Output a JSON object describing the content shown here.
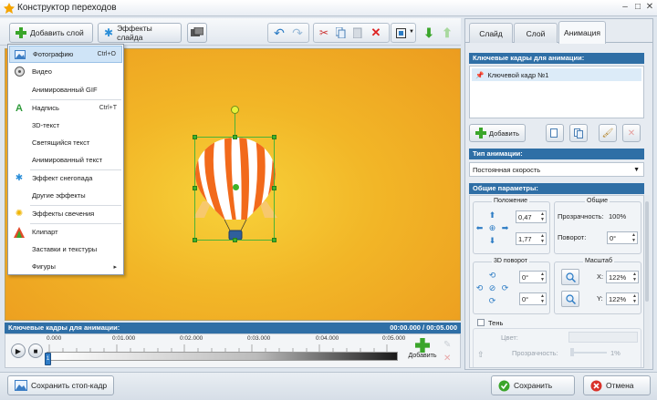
{
  "window": {
    "title": "Конструктор переходов",
    "controls": [
      "minimize-icon",
      "maximize-icon",
      "close-icon"
    ]
  },
  "toolbar": {
    "add_layer_label": "Добавить слой",
    "slide_effects_label": "Эффекты слайда",
    "icons": [
      "add-icon",
      "effects-icon",
      "slideshow-icon",
      "undo-icon",
      "redo-icon",
      "cut-icon",
      "copy-icon",
      "paste-icon",
      "delete-icon",
      "fit-icon",
      "move-down-icon",
      "move-up-icon"
    ]
  },
  "menu": {
    "items": [
      {
        "label": "Фотографию",
        "shortcut": "Ctrl+O",
        "icon": "photo-icon",
        "highlighted": true
      },
      {
        "label": "Видео",
        "shortcut": "",
        "icon": "video-icon"
      },
      {
        "label": "Анимированный GIF",
        "shortcut": "",
        "icon": "gif-icon"
      },
      {
        "label": "Надпись",
        "shortcut": "Ctrl+T",
        "icon": "text-icon"
      },
      {
        "label": "3D-текст",
        "shortcut": "",
        "icon": "text3d-icon"
      },
      {
        "label": "Светящийся текст",
        "shortcut": "",
        "icon": "glow-text-icon"
      },
      {
        "label": "Анимированный текст",
        "shortcut": "",
        "icon": "animated-text-icon"
      },
      {
        "label": "Эффект снегопада",
        "shortcut": "",
        "icon": "snowflake-icon"
      },
      {
        "label": "Другие эффекты",
        "shortcut": "",
        "icon": "effects-icon"
      },
      {
        "label": "Эффекты свечения",
        "shortcut": "",
        "icon": "glow-icon"
      },
      {
        "label": "Клипарт",
        "shortcut": "",
        "icon": "clipart-icon"
      },
      {
        "label": "Заставки и текстуры",
        "shortcut": "",
        "icon": "texture-icon"
      },
      {
        "label": "Фигуры",
        "shortcut": "",
        "icon": "shapes-icon",
        "submenu": true
      }
    ],
    "submenu_arrow": "▸"
  },
  "timeline": {
    "header": "Ключевые кадры для анимации:",
    "time": "00:00.000 / 00:05.000",
    "ticks": [
      "0.000",
      "0:01.000",
      "0:02.000",
      "0:03.000",
      "0:04.000",
      "0:05.000"
    ],
    "marker_label": "1",
    "add_label": "Добавить"
  },
  "bottom": {
    "save_frame_label": "Сохранить стоп-кадр",
    "save_label": "Сохранить",
    "cancel_label": "Отмена"
  },
  "panel": {
    "tabs": [
      "Слайд",
      "Слой",
      "Анимация"
    ],
    "active_tab": "Анимация",
    "keyframes_header": "Ключевые кадры для анимации:",
    "keyframe_item": "Ключевой кадр №1",
    "add_label": "Добавить",
    "anim_type_header": "Тип анимации:",
    "anim_type_value": "Постоянная скорость",
    "general_params_header": "Общие параметры:",
    "position_label": "Положение",
    "position_x": "0,47",
    "position_y": "1,77",
    "common_label": "Общие",
    "opacity_label": "Прозрачность:",
    "opacity_value": "100%",
    "rotation_label": "Поворот:",
    "rotation_value": "0°",
    "rotate3d_label": "3D поворот",
    "rotate3d_x": "0°",
    "rotate3d_y": "0°",
    "scale_label": "Масштаб",
    "scale_x_label": "X:",
    "scale_x": "122%",
    "scale_y_label": "Y:",
    "scale_y": "122%",
    "shadow_label": "Тень",
    "color_label": "Цвет:",
    "shadow_opacity_label": "Прозрачность:",
    "shadow_opacity_value": "1%"
  },
  "colors": {
    "accent": "#2f6fa6",
    "stage_top": "#f7d23a",
    "stage_bottom": "#ec9c1f",
    "balloon_orange": "#f26a1b",
    "selection": "#4bb336"
  }
}
